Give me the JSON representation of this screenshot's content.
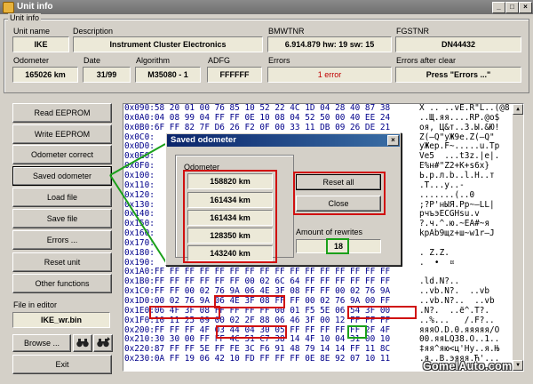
{
  "window": {
    "title": "Unit info"
  },
  "unit_info": {
    "group_label": "Unit info",
    "unit_name": {
      "label": "Unit name",
      "value": "IKE"
    },
    "description": {
      "label": "Description",
      "value": "Instrument Cluster Electronics"
    },
    "bmwtnr": {
      "label": "BMWTNR",
      "value": "6.914.879  hw: 19  sw: 15"
    },
    "fgstnr": {
      "label": "FGSTNR",
      "value": "DN44432"
    },
    "odometer": {
      "label": "Odometer",
      "value": "165026 km"
    },
    "date": {
      "label": "Date",
      "value": "31/99"
    },
    "algorithm": {
      "label": "Algorithm",
      "value": "M35080 - 1"
    },
    "adfg": {
      "label": "ADFG",
      "value": "FFFFFF"
    },
    "errors": {
      "label": "Errors",
      "value": "1 error"
    },
    "errors_after_clear": {
      "label": "Errors after clear",
      "value": "Press \"Errors ...\""
    }
  },
  "sidebar": {
    "buttons": [
      "Read EEPROM",
      "Write EEPROM",
      "Odometer correct",
      "Saved odometer",
      "Load file",
      "Save file",
      "Errors ...",
      "Reset unit",
      "Other functions"
    ],
    "file_label": "File in editor",
    "file_name": "IKE_wr.bin",
    "browse_label": "Browse ...",
    "exit_label": "Exit"
  },
  "hex_editor": {
    "rows": [
      {
        "addr": "0x090:",
        "bytes": "58 20 01 00 76 85 10 52 22 4C 1D 04 28 40 87 38",
        "ascii": "X .. ..vE.R\"L..(@8"
      },
      {
        "addr": "0x0A0:",
        "bytes": "04 08 99 04 FF FF 0E 10 08 04 52 50 00 40 EE 24",
        "ascii": "..Щ.яя....RP.@о$"
      },
      {
        "addr": "0x0B0:",
        "bytes": "6F FF 82 7F D6 26 F2 0F 00 33 11 DB 09 26 DE 21",
        "ascii": "oя‚ Ц&т..3.Ы.&Ю!"
      },
      {
        "addr": "0x0C0:",
        "bytes": "",
        "ascii": "Z(–Q\"уЖ9е.Z(–Q\""
      },
      {
        "addr": "0x0D0:",
        "bytes": "",
        "ascii": "уЖер.F~.....u.Тр"
      },
      {
        "addr": "0x0E0:",
        "bytes": "",
        "ascii": "Ve5  ...t3z.|е|."
      },
      {
        "addr": "0x0F0:",
        "bytes": "",
        "ascii": "Е%н#\"Z2+K+s6x}"
      },
      {
        "addr": "0x100:",
        "bytes": "",
        "ascii": "Ь.р.л.b..l.H..т"
      },
      {
        "addr": "0x110:",
        "bytes": "",
        "ascii": ".T...y..-"
      },
      {
        "addr": "0x120:",
        "bytes": "",
        "ascii": ".......(..0"
      },
      {
        "addr": "0x130:",
        "bytes": "",
        "ascii": ";?P'нЫЯ.Рр~–LL|"
      },
      {
        "addr": "0x140:",
        "bytes": "",
        "ascii": "рчъэЕCGHsu.v"
      },
      {
        "addr": "0x150:",
        "bytes": "",
        "ascii": "?.ч.^.ю.~ЕА#~я"
      },
      {
        "addr": "0x160:",
        "bytes": "",
        "ascii": "kрАb9щz+ш~w1r–J"
      },
      {
        "addr": "0x170:",
        "bytes": "",
        "ascii": ""
      },
      {
        "addr": "0x180:",
        "bytes": "",
        "ascii": ". Z.Z."
      },
      {
        "addr": "0x190:",
        "bytes": "",
        "ascii": ".  •  ¤"
      },
      {
        "addr": "0x1A0:",
        "bytes": "FF FF FF FF FF FF FF FF FF FF FF FF FF FF FF FF",
        "ascii": ""
      },
      {
        "addr": "0x1B0:",
        "bytes": "FF FF FF FF FF FF 00 02 6C 64 FF FF FF FF FF FF",
        "ascii": ".ld.N?.."
      },
      {
        "addr": "0x1C0:",
        "bytes": "FF FF 00 02 76 9A 06 4E 3F 08 FF FF 00 02 76 9A",
        "ascii": "..vb.N?.  ..vb"
      },
      {
        "addr": "0x1D0:",
        "bytes": "00 02 76 9A 06 4E 3F 08 FF FF 00 02 76 9A 00 FF",
        "ascii": "..vb.N?..  ..vb"
      },
      {
        "addr": "0x1E0:",
        "bytes": "06 4F 3F 08 FF FF FF FF 00 01 F5 5E 06 54 3F 00",
        "ascii": ".N?.  ..ё^.T?."
      },
      {
        "addr": "0x1F0:",
        "bytes": "10 11 25 09 00 02 2F 88 06 46 3F 00 12 FF FF FF",
        "ascii": "..%...   /.F?.."
      },
      {
        "addr": "0x200:",
        "bytes": "FF FF FF 4F 03 44 04 30 05 FF FF FF FF FF 2F 4F",
        "ascii": "яяяO.D.0.яяяяя/O"
      },
      {
        "addr": "0x210:",
        "bytes": "30 30 00 FF FF 4C 51 C7 38 14 4F 10 04 31 00 10",
        "ascii": "00.яяLQЗ8.O..1.."
      },
      {
        "addr": "0x220:",
        "bytes": "87 FF FF 5E FF FE 3C F6 91 48 79 14 14 FF 11 8C",
        "ascii": "‡яя^яю<ц'Hy..я.Њ"
      },
      {
        "addr": "0x230:",
        "bytes": "0A FF 19 06 42 10 FD FF FF FF 0E 8E 92 07 10 11",
        "ascii": ".я..B.эяяя.Ћ'..."
      }
    ]
  },
  "dialog": {
    "title": "Saved odometer",
    "odometer_label": "Odometer",
    "values": [
      "158820 km",
      "161434 km",
      "161434 km",
      "128350 km",
      "143240 km"
    ],
    "reset_all_label": "Reset all",
    "close_label": "Close",
    "rewrites_label": "Amount of rewrites",
    "rewrites_value": "18"
  },
  "watermark": "GomelAuto.com",
  "colors": {
    "highlight_red": "#d01010",
    "highlight_green": "#1aa01a",
    "dialog_title": "#0a246a"
  }
}
